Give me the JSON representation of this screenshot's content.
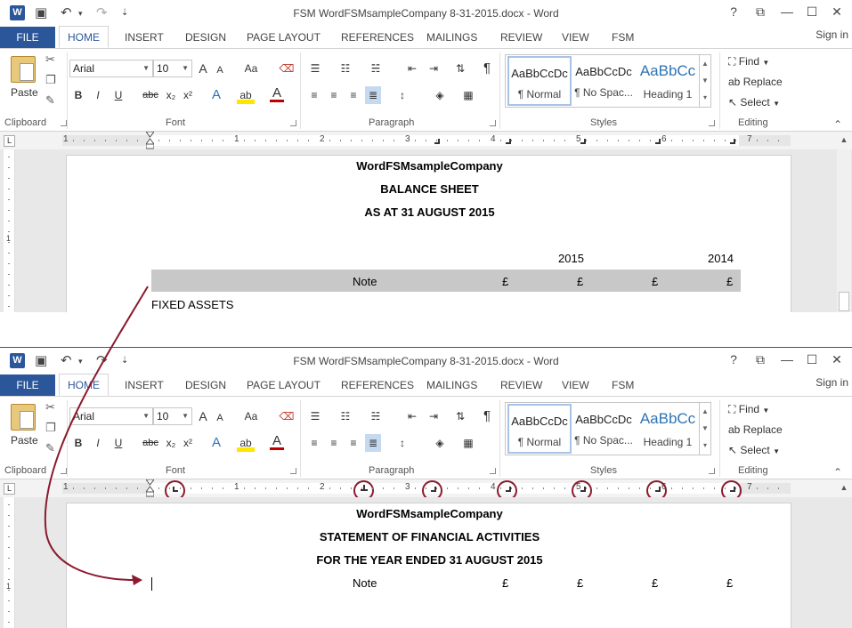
{
  "window": {
    "title": "FSM WordFSMsampleCompany 8-31-2015.docx - Word",
    "app_logo": "W",
    "help": "?",
    "restore_ribbon": "⧉",
    "minimize": "—",
    "maximize": "☐",
    "close": "✕"
  },
  "quick_access": {
    "save_icon": "💾",
    "undo_icon": "↶",
    "undo_dd": "▾",
    "redo_icon": "↷",
    "customize": "⇣"
  },
  "tabs": {
    "file": "FILE",
    "home": "HOME",
    "insert": "INSERT",
    "design": "DESIGN",
    "page_layout": "PAGE LAYOUT",
    "references": "REFERENCES",
    "mailings": "MAILINGS",
    "review": "REVIEW",
    "view": "VIEW",
    "fsm": "FSM",
    "signin": "Sign in"
  },
  "ribbon": {
    "clipboard": {
      "paste": "Paste",
      "label": "Clipboard"
    },
    "font": {
      "name": "Arial",
      "size": "10",
      "grow": "A",
      "shrink": "A",
      "case": "Aa",
      "bold": "B",
      "italic": "I",
      "underline": "U",
      "strike": "abc",
      "sub": "x₂",
      "sup": "x²",
      "text_effect": "A",
      "highlight": "ab",
      "font_color": "A",
      "label": "Font"
    },
    "paragraph": {
      "label": "Paragraph",
      "pilcrow": "¶"
    },
    "styles": {
      "label": "Styles",
      "items": [
        {
          "preview": "AaBbCcDc",
          "name": "¶ Normal"
        },
        {
          "preview": "AaBbCcDc",
          "name": "¶ No Spac..."
        },
        {
          "preview": "AaBbCc",
          "name": "Heading 1"
        }
      ]
    },
    "editing": {
      "find": "Find",
      "replace": "Replace",
      "select": "Select",
      "label": "Editing"
    }
  },
  "ruler": {
    "corner": "L",
    "numbers": [
      "1",
      "1",
      "2",
      "3",
      "4",
      "5",
      "6",
      "7"
    ]
  },
  "vruler": {
    "number": "1"
  },
  "doc_top": {
    "company": "WordFSMsampleCompany",
    "heading1": "BALANCE SHEET",
    "heading2": "AS AT 31 AUGUST 2015",
    "year1": "2015",
    "year2": "2014",
    "note": "Note",
    "currency": "£",
    "section": "FIXED ASSETS"
  },
  "doc_bottom": {
    "company": "WordFSMsampleCompany",
    "heading1": "STATEMENT OF FINANCIAL ACTIVITIES",
    "heading2": "FOR THE YEAR ENDED 31 AUGUST 2015",
    "note": "Note",
    "currency": "£"
  },
  "colors": {
    "accent": "#2b579a",
    "annotation": "#8b1a2e",
    "shade": "#c8c8c8"
  }
}
